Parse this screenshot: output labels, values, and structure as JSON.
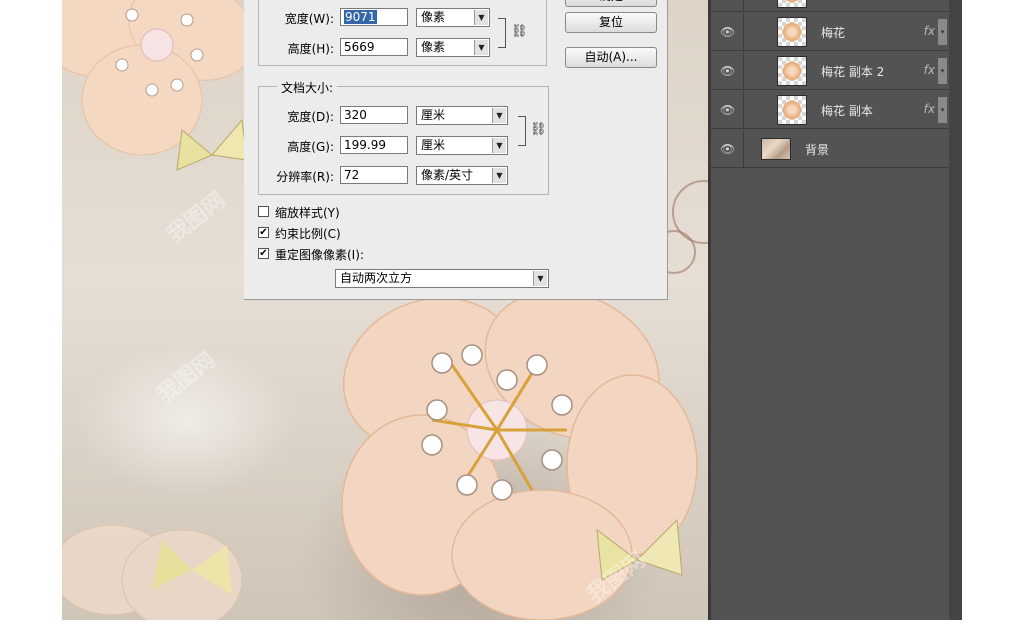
{
  "dialog": {
    "buttons": {
      "ok": "确定",
      "reset": "复位",
      "auto": "自动(A)..."
    },
    "pixel_dimensions": {
      "width_label": "宽度(W):",
      "width_value": "9071",
      "width_unit": "像素",
      "height_label": "高度(H):",
      "height_value": "5669",
      "height_unit": "像素"
    },
    "document_size": {
      "legend": "文档大小:",
      "width_label": "宽度(D):",
      "width_value": "320",
      "width_unit": "厘米",
      "height_label": "高度(G):",
      "height_value": "199.99",
      "height_unit": "厘米",
      "resolution_label": "分辨率(R):",
      "resolution_value": "72",
      "resolution_unit": "像素/英寸"
    },
    "options": {
      "scale_styles": {
        "label": "缩放样式(Y)",
        "checked": false
      },
      "constrain_proportions": {
        "label": "约束比例(C)",
        "checked": true
      },
      "resample_image": {
        "label": "重定图像像素(I):",
        "checked": true
      },
      "resample_method": "自动两次立方"
    }
  },
  "layers": [
    {
      "name": "梅花",
      "fx": "fx",
      "type": "flower"
    },
    {
      "name": "梅花 副本 2",
      "fx": "fx",
      "type": "flower"
    },
    {
      "name": "梅花 副本",
      "fx": "fx",
      "type": "flower"
    },
    {
      "name": "背景",
      "fx": "",
      "type": "background"
    }
  ],
  "icons": {
    "eye": "visibility-eye-icon",
    "chain": "link-chain-icon",
    "arrow": "dropdown-arrow-icon"
  },
  "watermark": "我图网",
  "colors": {
    "panel_bg": "#535353",
    "dialog_bg": "#ececec",
    "selection": "#3366aa"
  }
}
